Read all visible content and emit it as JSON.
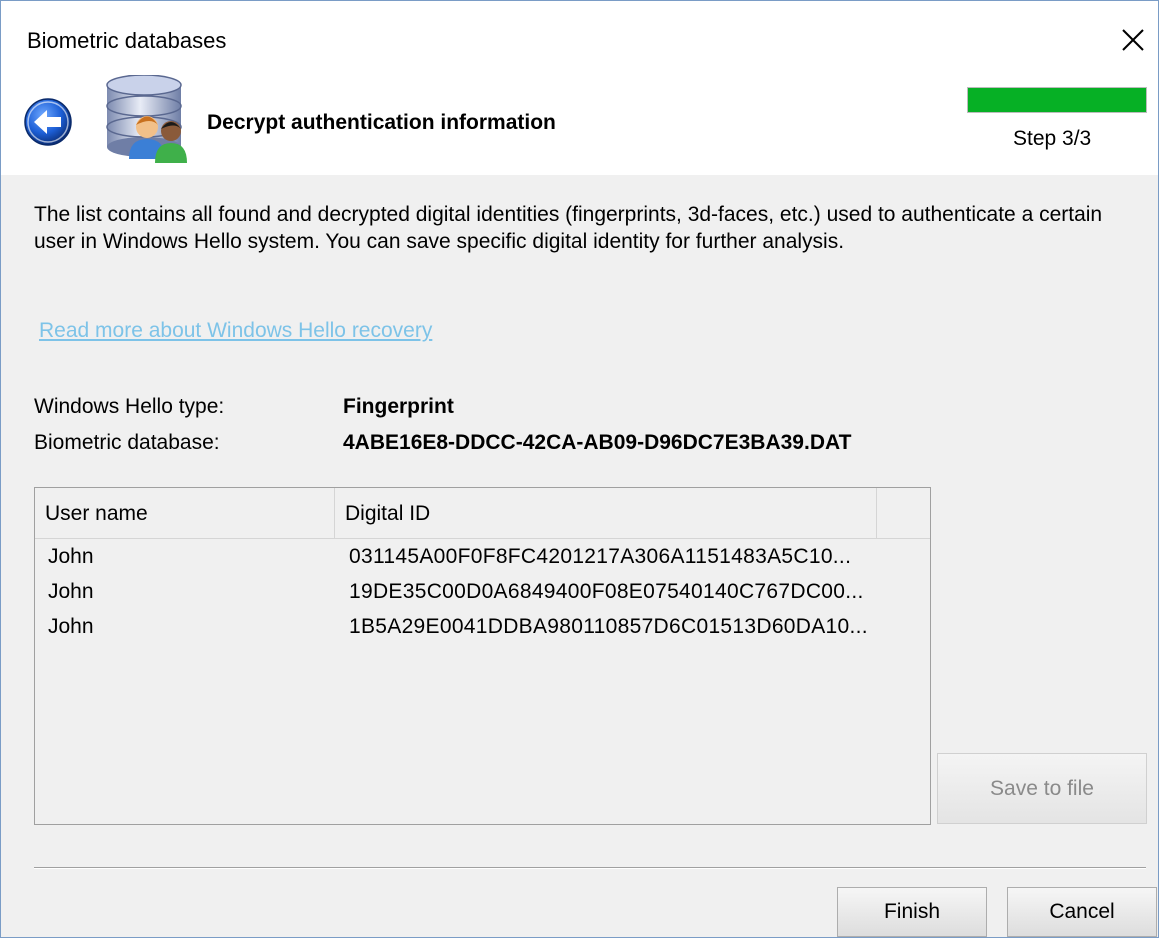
{
  "window": {
    "title": "Biometric databases"
  },
  "header": {
    "title": "Decrypt authentication information",
    "step_label": "Step 3/3",
    "progress_fraction": 1.0,
    "progress_color": "#06b025"
  },
  "description": "The list contains all found and decrypted digital identities (fingerprints, 3d-faces, etc.) used to authenticate a certain user in Windows Hello system. You can save specific digital identity for further analysis.",
  "link_text": "Read more about Windows Hello recovery",
  "fields": {
    "type_label": "Windows Hello type:",
    "type_value": "Fingerprint",
    "db_label": "Biometric database:",
    "db_value": "4ABE16E8-DDCC-42CA-AB09-D96DC7E3BA39.DAT"
  },
  "table": {
    "columns": [
      "User name",
      "Digital ID"
    ],
    "rows": [
      {
        "user": "John",
        "id": "031145A00F0F8FC4201217A306A1151483A5C10..."
      },
      {
        "user": "John",
        "id": "19DE35C00D0A6849400F08E07540140C767DC00..."
      },
      {
        "user": "John",
        "id": "1B5A29E0041DDBA980110857D6C01513D60DA10..."
      }
    ]
  },
  "buttons": {
    "save": "Save to file",
    "finish": "Finish",
    "cancel": "Cancel"
  },
  "icons": {
    "close": "close-icon",
    "back": "back-arrow-icon",
    "database": "database-users-icon"
  }
}
